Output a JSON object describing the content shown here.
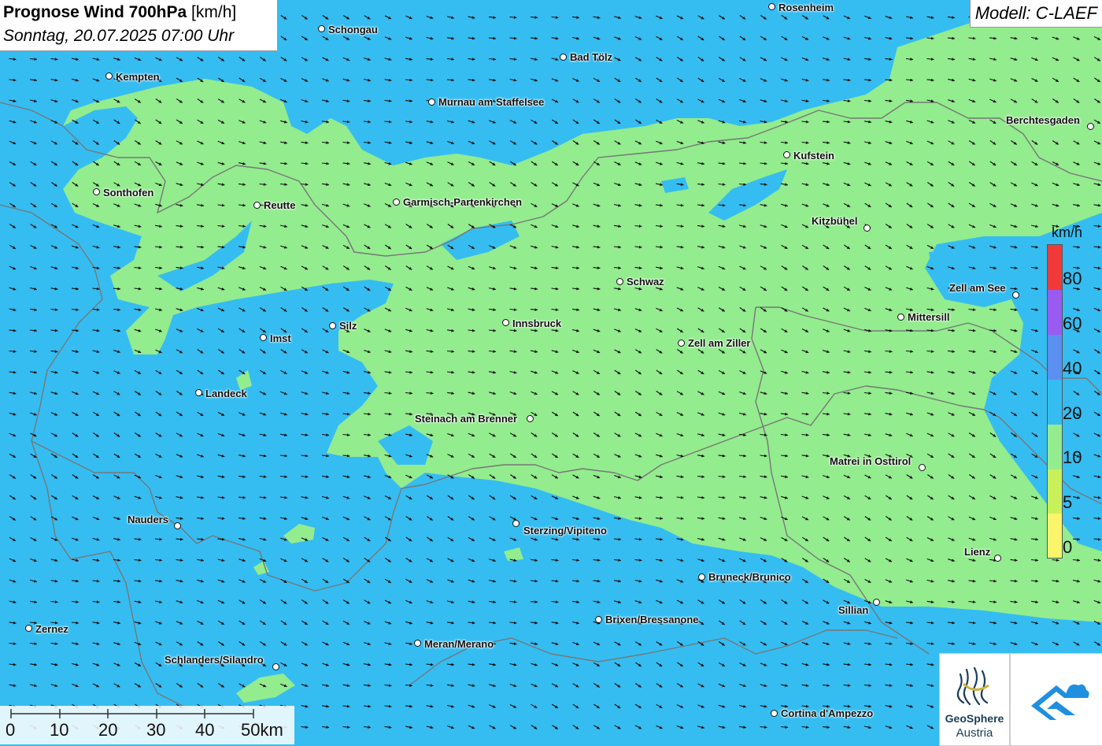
{
  "header": {
    "title": "Prognose Wind 700hPa",
    "unit": "[km/h]",
    "datetime": "Sonntag, 20.07.2025 07:00 Uhr",
    "model": "Modell: C-LAEF"
  },
  "cities": [
    {
      "name": "Rosenheim",
      "label": "Rosenheim"
    },
    {
      "name": "Schongau",
      "label": "Schongau"
    },
    {
      "name": "Bad Tölz",
      "label": "Bad Tölz"
    },
    {
      "name": "Kempten",
      "label": "Kempten"
    },
    {
      "name": "Murnau am Staffelsee",
      "label": "Murnau am Staffelsee"
    },
    {
      "name": "Berchtesgaden",
      "label": "Berchtesgaden"
    },
    {
      "name": "Kufstein",
      "label": "Kufstein"
    },
    {
      "name": "Sonthofen",
      "label": "Sonthofen"
    },
    {
      "name": "Reutte",
      "label": "Reutte"
    },
    {
      "name": "Garmisch-Partenkirchen",
      "label": "Garmisch-Partenkirchen"
    },
    {
      "name": "Kitzbühel",
      "label": "Kitzbühel"
    },
    {
      "name": "Schwaz",
      "label": "Schwaz"
    },
    {
      "name": "Zell am See",
      "label": "Zell am See"
    },
    {
      "name": "Innsbruck",
      "label": "Innsbruck"
    },
    {
      "name": "Silz",
      "label": "Silz"
    },
    {
      "name": "Mittersill",
      "label": "Mittersill"
    },
    {
      "name": "Imst",
      "label": "Imst"
    },
    {
      "name": "Zell am Ziller",
      "label": "Zell am Ziller"
    },
    {
      "name": "Landeck",
      "label": "Landeck"
    },
    {
      "name": "Steinach am Brenner",
      "label": "Steinach am Brenner"
    },
    {
      "name": "Matrei in Osttirol",
      "label": "Matrei in Osttirol"
    },
    {
      "name": "Nauders",
      "label": "Nauders"
    },
    {
      "name": "Sterzing/Vipiteno",
      "label": "Sterzing/Vipiteno"
    },
    {
      "name": "Lienz",
      "label": "Lienz"
    },
    {
      "name": "Bruneck/Brunico",
      "label": "Bruneck/Brunico"
    },
    {
      "name": "Sillian",
      "label": "Sillian"
    },
    {
      "name": "Brixen/Bressanone",
      "label": "Brixen/Bressanone"
    },
    {
      "name": "Zernez",
      "label": "Zernez"
    },
    {
      "name": "Meran/Merano",
      "label": "Meran/Merano"
    },
    {
      "name": "Schlanders/Silandro",
      "label": "Schlanders/Silandro"
    },
    {
      "name": "Cortina d'Ampezzo",
      "label": "Cortina d'Ampezzo"
    }
  ],
  "legend": {
    "unit": "km/h",
    "labels": [
      "80",
      "60",
      "40",
      "20",
      "10",
      "5",
      "0"
    ],
    "colors": [
      "#f03a3a",
      "#9a5cf0",
      "#5b8ff0",
      "#35bdf2",
      "#93ec8e",
      "#c9f05a",
      "#fbf56c"
    ]
  },
  "scale": {
    "labels": [
      "0",
      "10",
      "20",
      "30",
      "40",
      "50km"
    ]
  },
  "logos": {
    "geosphere_line1": "GeoSphere",
    "geosphere_line2": "Austria"
  },
  "colors": {
    "calm_area": "#93ec8e",
    "wind_area": "#35bdf2",
    "arrow": "#111111"
  }
}
